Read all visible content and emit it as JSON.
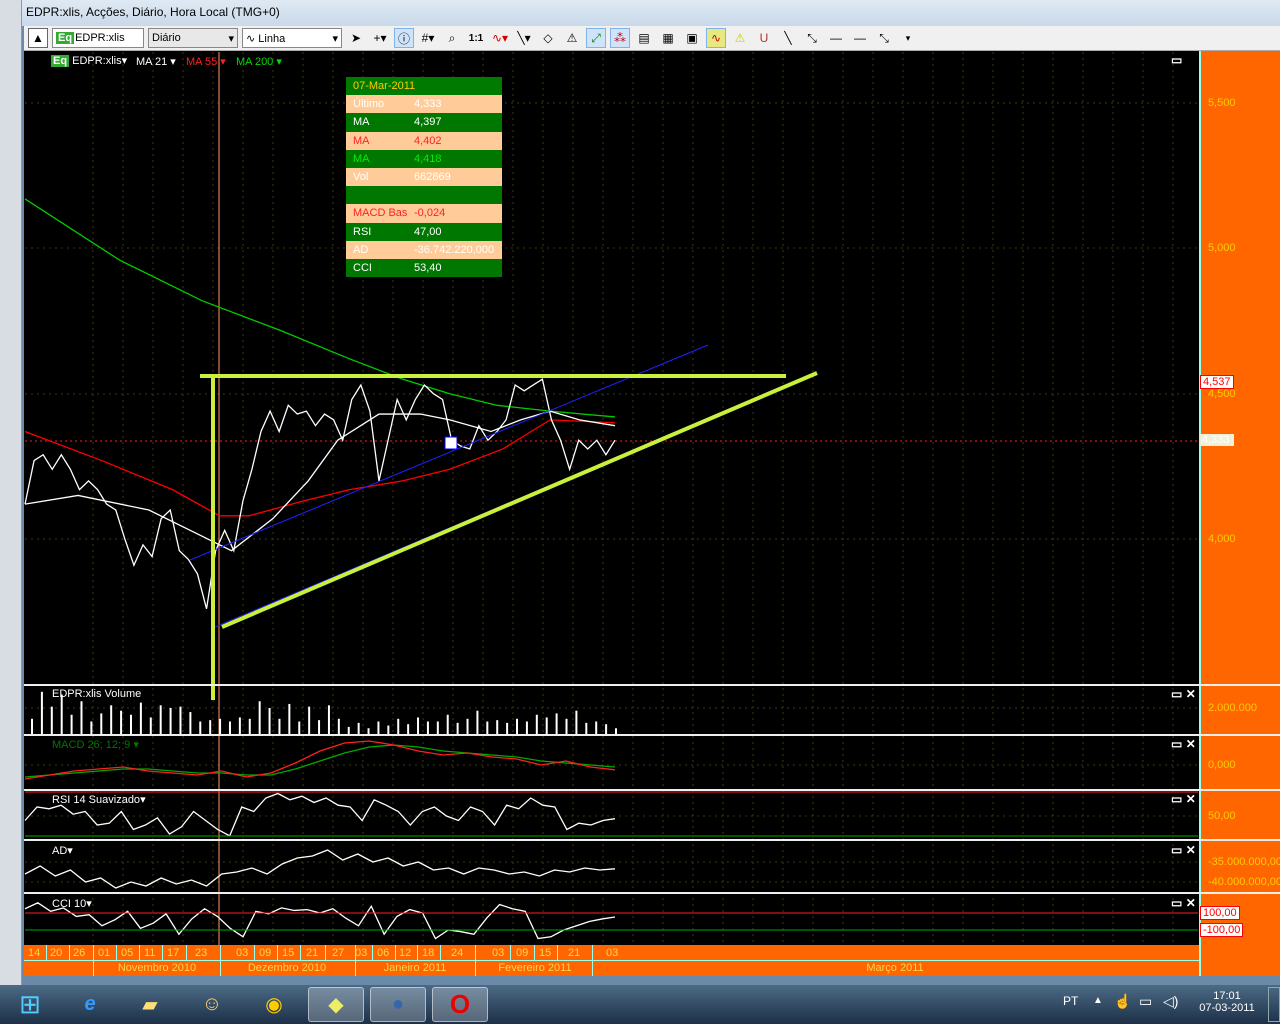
{
  "window": {
    "title": "EDPR:xlis, Acções, Diário, Hora Local (TMG+0)"
  },
  "toolbar": {
    "symbol": "EDPR:xlis",
    "symbol_badge": "Eq",
    "period": "Diário",
    "chart_type": "Linha",
    "icons": [
      "collapse-icon",
      "pointer-icon",
      "crosshair-icon",
      "info-icon",
      "grid-icon",
      "zoom-icon",
      "one-to-one-icon",
      "indicator-icon",
      "line-tool-icon",
      "eraser-icon",
      "alert-tool-icon",
      "trendline-icon",
      "studies-icon",
      "template-icon",
      "copy-chart-icon",
      "chart-image-icon",
      "wave-icon",
      "warning-icon",
      "magnet-icon",
      "line-icon",
      "ray-icon",
      "horizontal-line-icon",
      "horizontal-line-2-icon",
      "extended-line-icon",
      "more-icon"
    ],
    "one_to_one": "1:1"
  },
  "legend": {
    "symbol": "EDPR:xlis",
    "badge": "Eq",
    "ma21": "MA 21",
    "ma55": "MA 55",
    "ma200": "MA 200"
  },
  "colors": {
    "ma21": "#ffffff",
    "ma55": "#ff0000",
    "ma200": "#00cc00",
    "price": "#ffffff",
    "annotation": "#c8f03c",
    "trend": "#2020ff",
    "axis_bg": "#ff6600"
  },
  "info": {
    "date": "07-Mar-2011",
    "rows": [
      {
        "label": "Último",
        "value": "4,333",
        "style": "p",
        "color": "#ffffff"
      },
      {
        "label": "MA",
        "value": "4,397",
        "style": "g",
        "color": "#ffffff"
      },
      {
        "label": "MA",
        "value": "4,402",
        "style": "p",
        "color": "#ff2020"
      },
      {
        "label": "MA",
        "value": "4,418",
        "style": "g",
        "color": "#00ee00"
      },
      {
        "label": "Vol",
        "value": "662869",
        "style": "p",
        "color": "#ffffff"
      },
      {
        "label": "",
        "value": "",
        "style": "g",
        "color": "#ffffff"
      },
      {
        "label": "MACD Bas",
        "value": "-0,024",
        "style": "p",
        "color": "#ff2020"
      },
      {
        "label": "RSI",
        "value": "47,00",
        "style": "g",
        "color": "#ffffff"
      },
      {
        "label": "AD",
        "value": "-36.742.220,000",
        "style": "p",
        "color": "#ffffff"
      },
      {
        "label": "CCI",
        "value": "53,40",
        "style": "g",
        "color": "#ffffff"
      }
    ]
  },
  "price_axis": {
    "ticks": [
      "5,500",
      "5,000",
      "4,500",
      "4,000"
    ],
    "marker_high": "4,537",
    "marker_last": "4,333"
  },
  "panels": {
    "volume": {
      "title": "EDPR:xlis Volume",
      "tick": "2.000.000"
    },
    "macd": {
      "title": "MACD 26; 12; 9",
      "tick": "0,000"
    },
    "rsi": {
      "title": "RSI 14 Suavizado",
      "tick": "50,00"
    },
    "ad": {
      "title": "AD",
      "ticks": [
        "-35.000.000,00",
        "-40.000.000,00"
      ]
    },
    "cci": {
      "title": "CCI 10",
      "ticks": [
        "100,00",
        "-100,00"
      ]
    }
  },
  "dates": {
    "days": [
      "14",
      "20",
      "26",
      "01",
      "05",
      "11",
      "17",
      "23",
      "03",
      "09",
      "15",
      "21",
      "27",
      "03",
      "06",
      "12",
      "18",
      "24",
      "03",
      "09",
      "15",
      "21",
      "03"
    ],
    "months": [
      "Novembro 2010",
      "Dezembro 2010",
      "Janeiro 2011",
      "Fevereiro 2011",
      "Março 2011"
    ]
  },
  "clock": {
    "time": "17:01",
    "date": "07-03-2011"
  },
  "tray": {
    "language": "PT"
  },
  "chart_data": {
    "type": "line",
    "title": "EDPR:xlis",
    "ylim": [
      3.7,
      5.6
    ],
    "close": [
      4.12,
      4.27,
      4.29,
      4.24,
      4.29,
      4.24,
      4.17,
      4.2,
      4.17,
      4.12,
      4.1,
      4.0,
      3.91,
      3.98,
      3.94,
      4.07,
      4.1,
      3.96,
      3.93,
      3.88,
      3.76,
      3.96,
      4.03,
      3.96,
      4.13,
      4.24,
      4.37,
      4.44,
      4.37,
      4.46,
      4.43,
      4.44,
      4.39,
      4.43,
      4.41,
      4.34,
      4.48,
      4.53,
      4.44,
      4.2,
      4.34,
      4.48,
      4.41,
      4.48,
      4.53,
      4.5,
      4.48,
      4.34,
      4.32,
      4.31,
      4.39,
      4.34,
      4.37,
      4.41,
      4.53,
      4.51,
      4.53,
      4.55,
      4.41,
      4.34,
      4.24,
      4.34,
      4.31,
      4.34,
      4.29,
      4.34
    ],
    "ma21": [
      [
        0,
        4.12
      ],
      [
        9,
        4.15
      ],
      [
        21,
        4.1
      ],
      [
        31,
        4.0
      ],
      [
        35,
        3.96
      ],
      [
        42,
        4.07
      ],
      [
        48,
        4.2
      ],
      [
        53,
        4.34
      ],
      [
        60,
        4.43
      ],
      [
        67,
        4.43
      ],
      [
        72,
        4.41
      ],
      [
        79,
        4.37
      ],
      [
        84,
        4.41
      ],
      [
        89,
        4.44
      ],
      [
        94,
        4.41
      ],
      [
        100,
        4.39
      ]
    ],
    "ma55": [
      [
        0,
        4.37
      ],
      [
        13,
        4.27
      ],
      [
        25,
        4.17
      ],
      [
        33,
        4.08
      ],
      [
        38,
        4.08
      ],
      [
        47,
        4.13
      ],
      [
        55,
        4.17
      ],
      [
        64,
        4.2
      ],
      [
        72,
        4.24
      ],
      [
        81,
        4.31
      ],
      [
        89,
        4.41
      ],
      [
        100,
        4.4
      ]
    ],
    "ma200": [
      [
        0,
        5.17
      ],
      [
        16,
        4.96
      ],
      [
        30,
        4.82
      ],
      [
        43,
        4.72
      ],
      [
        55,
        4.62
      ],
      [
        64,
        4.55
      ],
      [
        72,
        4.5
      ],
      [
        80,
        4.46
      ],
      [
        89,
        4.44
      ],
      [
        100,
        4.42
      ]
    ],
    "volume_m": [
      1.2,
      3.2,
      2.1,
      3.0,
      1.5,
      2.5,
      1.0,
      1.6,
      2.2,
      1.8,
      1.5,
      2.4,
      1.3,
      2.2,
      2.0,
      2.1,
      1.7,
      1.0,
      1.1,
      1.2,
      1.0,
      1.3,
      1.2,
      2.5,
      2.0,
      1.2,
      2.3,
      1.0,
      2.1,
      1.1,
      2.2,
      1.2,
      0.6,
      0.9,
      0.5,
      1.0,
      0.7,
      1.2,
      0.8,
      1.3,
      1.0,
      1.0,
      1.5,
      0.9,
      1.2,
      1.8,
      1.0,
      1.1,
      0.9,
      1.2,
      1.0,
      1.5,
      1.3,
      1.6,
      1.2,
      1.8,
      0.9,
      1.0,
      0.8,
      0.5
    ],
    "macd": [
      -0.07,
      -0.05,
      -0.03,
      -0.02,
      -0.01,
      -0.03,
      -0.04,
      -0.05,
      -0.03,
      -0.06,
      -0.04,
      0.01,
      0.07,
      0.11,
      0.12,
      0.1,
      0.07,
      0.05,
      0.06,
      0.04,
      0.03,
      0.0,
      0.02,
      -0.01,
      -0.024
    ],
    "macd_signal": [
      -0.06,
      -0.05,
      -0.04,
      -0.03,
      -0.02,
      -0.02,
      -0.03,
      -0.04,
      -0.04,
      -0.05,
      -0.05,
      -0.02,
      0.02,
      0.06,
      0.09,
      0.1,
      0.09,
      0.07,
      0.06,
      0.05,
      0.04,
      0.02,
      0.01,
      0.0,
      -0.01
    ],
    "rsi": [
      45,
      60,
      58,
      62,
      52,
      55,
      40,
      42,
      55,
      35,
      40,
      48,
      30,
      38,
      55,
      45,
      35,
      28,
      60,
      55,
      70,
      75,
      68,
      72,
      65,
      70,
      62,
      60,
      45,
      68,
      62,
      55,
      40,
      55,
      60,
      50,
      45,
      60,
      55,
      40,
      62,
      58,
      70,
      62,
      60,
      35,
      42,
      40,
      45,
      47
    ],
    "ad_m": [
      -38,
      -36,
      -38.5,
      -37,
      -40,
      -39,
      -41.5,
      -40,
      -41,
      -39,
      -40.5,
      -39.5,
      -41,
      -38,
      -37.5,
      -36.5,
      -38,
      -35.5,
      -34,
      -33.5,
      -32,
      -34.5,
      -33,
      -35,
      -34,
      -36,
      -35,
      -37,
      -36.5,
      -38,
      -36.5,
      -37,
      -38,
      -37.5,
      -38.5,
      -37,
      -37.5,
      -36.5,
      -37,
      -36.7
    ],
    "cci": [
      150,
      220,
      120,
      160,
      60,
      80,
      -50,
      20,
      120,
      -80,
      -20,
      90,
      -150,
      30,
      150,
      60,
      -80,
      -180,
      120,
      90,
      160,
      130,
      140,
      100,
      150,
      40,
      -50,
      180,
      -150,
      60,
      140,
      100,
      -200,
      -100,
      -120,
      -150,
      40,
      200,
      150,
      120,
      -200,
      -180,
      -100,
      -50,
      0,
      30,
      53
    ]
  }
}
